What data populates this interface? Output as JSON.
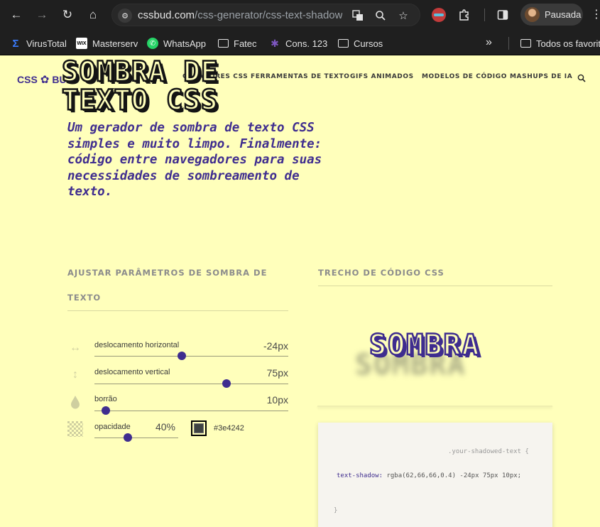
{
  "browser": {
    "url_domain": "cssbud.com",
    "url_path": "/css-generator/css-text-shadow-g...",
    "profile_label": "Pausada",
    "icons": [
      "back-icon",
      "forward-icon",
      "reload-icon",
      "home-icon",
      "tune-icon",
      "translate-icon",
      "zoom-icon",
      "star-icon",
      "extension-icon",
      "sidepanel-icon",
      "menu-icon"
    ]
  },
  "bookmarks": {
    "items": [
      {
        "label": "VirusTotal",
        "icon": "virustotal-icon"
      },
      {
        "label": "Masterserv",
        "icon": "wix-icon"
      },
      {
        "label": "WhatsApp",
        "icon": "whatsapp-icon"
      },
      {
        "label": "Fatec",
        "icon": "folder-icon"
      },
      {
        "label": "Cons. 123",
        "icon": "cons-icon"
      },
      {
        "label": "Cursos",
        "icon": "folder-icon"
      }
    ],
    "more": "»",
    "all_bookmarks": "Todos os favoritos"
  },
  "site": {
    "logo_left": "CSS",
    "logo_right": "BUD",
    "nav": [
      "GERADORES CSS",
      "FERRAMENTAS DE TEXTO",
      "GIFS ANIMADOS",
      "MODELOS DE CÓDIGO",
      "MASHUPS DE IA"
    ]
  },
  "hero": {
    "title": "SOMBRA DE TEXTO CSS",
    "subtitle": "Um gerador de sombra de texto CSS simples e muito limpo. Finalmente: código entre navegadores para suas necessidades de sombreamento de texto."
  },
  "params": {
    "heading": "AJUSTAR PARÂMETROS DE SOMBRA DE TEXTO",
    "horizontal": {
      "label": "deslocamento horizontal",
      "value": "-24px",
      "level": 0.45
    },
    "vertical": {
      "label": "deslocamento vertical",
      "value": "75px",
      "level": 0.68
    },
    "blur": {
      "label": "borrão",
      "value": "10px",
      "level": 0.06
    },
    "opacity": {
      "label": "opacidade",
      "value": "40%",
      "level": 0.4
    },
    "color_hex": "#3e4242"
  },
  "code": {
    "heading": "TRECHO DE CÓDIGO CSS",
    "preview_text": "SOMBRA",
    "selector": ".your-shadowed-text {",
    "property": "text-shadow:",
    "value": "rgba(62,66,66,0.4) -24px 75px 10px;",
    "close": "}"
  },
  "colors": {
    "page_bg": "#ffffbb",
    "accent": "#3f2d8f",
    "shadow_color": "#3e4242",
    "chrome_bg": "#1f1f1f"
  }
}
